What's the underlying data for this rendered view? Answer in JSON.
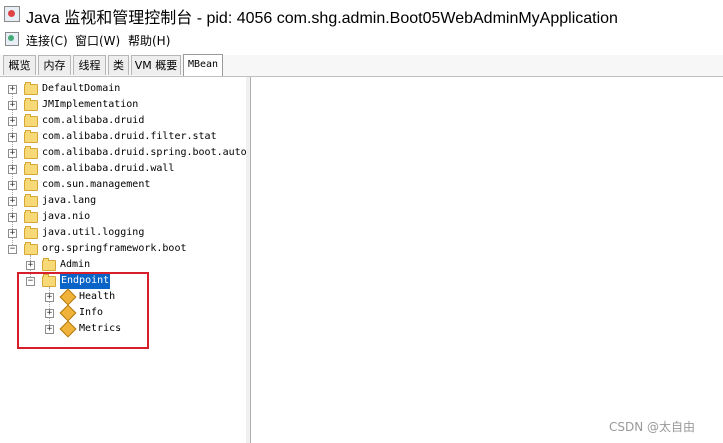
{
  "window": {
    "title": "Java 监视和管理控制台 - pid: 4056 com.shg.admin.Boot05WebAdminMyApplication"
  },
  "menu": {
    "items": [
      "连接(C)",
      "窗口(W)",
      "帮助(H)"
    ]
  },
  "tabs": [
    "概览",
    "内存",
    "线程",
    "类",
    "VM 概要",
    "MBean"
  ],
  "active_tab": "MBean",
  "tree": {
    "roots": [
      "DefaultDomain",
      "JMImplementation",
      "com.alibaba.druid",
      "com.alibaba.druid.filter.stat",
      "com.alibaba.druid.spring.boot.auto",
      "com.alibaba.druid.wall",
      "com.sun.management",
      "java.lang",
      "java.nio",
      "java.util.logging",
      "org.springframework.boot"
    ],
    "children": [
      "Admin",
      "Endpoint"
    ],
    "endpoint_children": [
      "Health",
      "Info",
      "Metrics"
    ],
    "selected": "Endpoint"
  },
  "watermark": "CSDN @太自由",
  "colors": {
    "highlight": "#d61f2b",
    "selection": "#0a64c8",
    "folder": "#f7d978"
  }
}
